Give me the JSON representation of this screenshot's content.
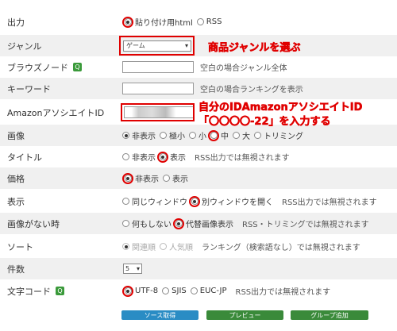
{
  "rows": {
    "output": {
      "label": "出力",
      "opts": [
        "貼り付け用html",
        "RSS"
      ]
    },
    "genre": {
      "label": "ジャンル",
      "value": "ゲーム"
    },
    "browse": {
      "label": "ブラウズノード",
      "note": "空白の場合ジャンル全体"
    },
    "keyword": {
      "label": "キーワード",
      "note": "空白の場合ランキングを表示"
    },
    "associate": {
      "label": "AmazonアソシエイトID"
    },
    "image": {
      "label": "画像",
      "opts": [
        "非表示",
        "極小",
        "小",
        "中",
        "大",
        "トリミング"
      ]
    },
    "title": {
      "label": "タイトル",
      "opts": [
        "非表示",
        "表示"
      ],
      "note": "RSS出力では無視されます"
    },
    "price": {
      "label": "価格",
      "opts": [
        "非表示",
        "表示"
      ]
    },
    "display": {
      "label": "表示",
      "opts": [
        "同じウィンドウ",
        "別ウィンドウを開く"
      ],
      "note": "RSS出力では無視されます"
    },
    "noimage": {
      "label": "画像がない時",
      "opts": [
        "何もしない",
        "代替画像表示"
      ],
      "note": "RSS・トリミングでは無視されます"
    },
    "sort": {
      "label": "ソート",
      "opts": [
        "関連順",
        "人気順"
      ],
      "note": "ランキング（検索語なし）では無視されます"
    },
    "count": {
      "label": "件数",
      "value": "5"
    },
    "charset": {
      "label": "文字コード",
      "opts": [
        "UTF-8",
        "SJIS",
        "EUC-JP"
      ],
      "note": "RSS出力では無視されます"
    }
  },
  "annotations": {
    "genre": "商品ジャンルを選ぶ",
    "id_line1": "自分のIDAmazonアソシエイトID",
    "id_line2": "「〇〇〇〇-22」を入力する"
  },
  "buttons": {
    "source": "ソース取得",
    "preview": "プレビュー",
    "group": "グループ追加"
  },
  "colors": {
    "accent": "#e00000",
    "blue_button": "#2a8cc4",
    "green_button": "#3a8a3a"
  }
}
